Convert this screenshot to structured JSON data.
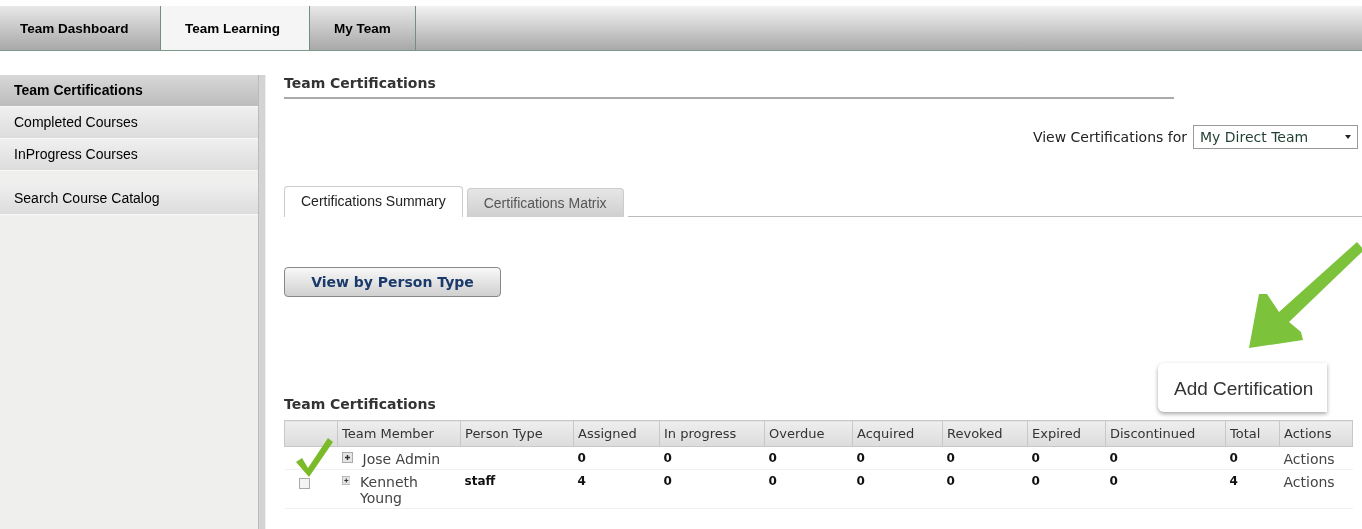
{
  "top_tabs": [
    {
      "label": "Team Dashboard",
      "selected": false
    },
    {
      "label": "Team Learning",
      "selected": true
    },
    {
      "label": "My Team",
      "selected": false
    }
  ],
  "sidebar": {
    "items": [
      {
        "label": "Team Certifications",
        "selected": true
      },
      {
        "label": "Completed Courses",
        "selected": false
      },
      {
        "label": "InProgress Courses",
        "selected": false
      },
      {
        "label": "Search Course Catalog",
        "selected": false
      }
    ]
  },
  "page_title": "Team Certifications",
  "filter": {
    "label": "View Certifications for",
    "value": "My Direct Team"
  },
  "tabs": [
    {
      "label": "Certifications Summary",
      "selected": true
    },
    {
      "label": "Certifications Matrix",
      "selected": false
    }
  ],
  "view_button": "View by Person Type",
  "callout": "Add Certification",
  "table": {
    "title": "Team Certifications",
    "columns": [
      "Team Member",
      "Person Type",
      "Assigned",
      "In progress",
      "Overdue",
      "Acquired",
      "Revoked",
      "Expired",
      "Discontinued",
      "Total",
      "Actions"
    ],
    "rows": [
      {
        "cells": [
          "Jose Admin",
          "",
          "0",
          "0",
          "0",
          "0",
          "0",
          "0",
          "0",
          "0",
          "Actions"
        ]
      },
      {
        "checked": false,
        "cells": [
          "Kenneth Young",
          "staff",
          "4",
          "0",
          "0",
          "0",
          "0",
          "0",
          "0",
          "4",
          "Actions"
        ]
      }
    ]
  }
}
